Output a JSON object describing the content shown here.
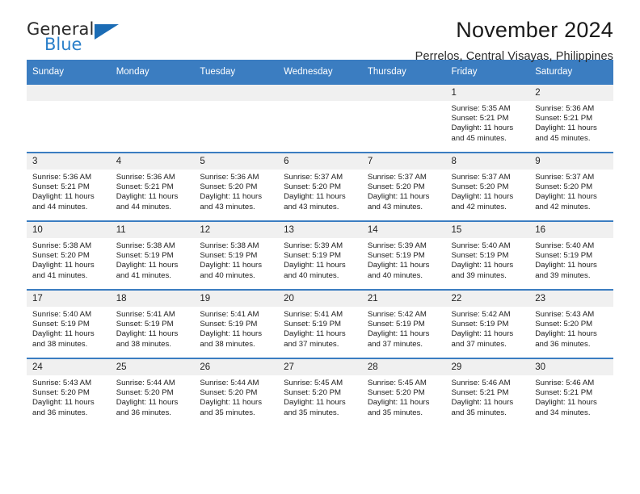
{
  "brand": {
    "name_top": "General",
    "name_bottom": "Blue",
    "accent_color": "#2a7fc9",
    "triangle_color": "#1b6cb5"
  },
  "header": {
    "title": "November 2024",
    "subtitle": "Perrelos, Central Visayas, Philippines",
    "header_bg_color": "#3b7dc1",
    "daynum_bg_color": "#f0f0f0"
  },
  "weekdays": [
    "Sunday",
    "Monday",
    "Tuesday",
    "Wednesday",
    "Thursday",
    "Friday",
    "Saturday"
  ],
  "labels": {
    "sunrise": "Sunrise:",
    "sunset": "Sunset:",
    "daylight": "Daylight:"
  },
  "weeks": [
    [
      {
        "day": "",
        "blank": true
      },
      {
        "day": "",
        "blank": true
      },
      {
        "day": "",
        "blank": true
      },
      {
        "day": "",
        "blank": true
      },
      {
        "day": "",
        "blank": true
      },
      {
        "day": "1",
        "sunrise": "Sunrise: 5:35 AM",
        "sunset": "Sunset: 5:21 PM",
        "daylight": "Daylight: 11 hours and 45 minutes."
      },
      {
        "day": "2",
        "sunrise": "Sunrise: 5:36 AM",
        "sunset": "Sunset: 5:21 PM",
        "daylight": "Daylight: 11 hours and 45 minutes."
      }
    ],
    [
      {
        "day": "3",
        "sunrise": "Sunrise: 5:36 AM",
        "sunset": "Sunset: 5:21 PM",
        "daylight": "Daylight: 11 hours and 44 minutes."
      },
      {
        "day": "4",
        "sunrise": "Sunrise: 5:36 AM",
        "sunset": "Sunset: 5:21 PM",
        "daylight": "Daylight: 11 hours and 44 minutes."
      },
      {
        "day": "5",
        "sunrise": "Sunrise: 5:36 AM",
        "sunset": "Sunset: 5:20 PM",
        "daylight": "Daylight: 11 hours and 43 minutes."
      },
      {
        "day": "6",
        "sunrise": "Sunrise: 5:37 AM",
        "sunset": "Sunset: 5:20 PM",
        "daylight": "Daylight: 11 hours and 43 minutes."
      },
      {
        "day": "7",
        "sunrise": "Sunrise: 5:37 AM",
        "sunset": "Sunset: 5:20 PM",
        "daylight": "Daylight: 11 hours and 43 minutes."
      },
      {
        "day": "8",
        "sunrise": "Sunrise: 5:37 AM",
        "sunset": "Sunset: 5:20 PM",
        "daylight": "Daylight: 11 hours and 42 minutes."
      },
      {
        "day": "9",
        "sunrise": "Sunrise: 5:37 AM",
        "sunset": "Sunset: 5:20 PM",
        "daylight": "Daylight: 11 hours and 42 minutes."
      }
    ],
    [
      {
        "day": "10",
        "sunrise": "Sunrise: 5:38 AM",
        "sunset": "Sunset: 5:20 PM",
        "daylight": "Daylight: 11 hours and 41 minutes."
      },
      {
        "day": "11",
        "sunrise": "Sunrise: 5:38 AM",
        "sunset": "Sunset: 5:19 PM",
        "daylight": "Daylight: 11 hours and 41 minutes."
      },
      {
        "day": "12",
        "sunrise": "Sunrise: 5:38 AM",
        "sunset": "Sunset: 5:19 PM",
        "daylight": "Daylight: 11 hours and 40 minutes."
      },
      {
        "day": "13",
        "sunrise": "Sunrise: 5:39 AM",
        "sunset": "Sunset: 5:19 PM",
        "daylight": "Daylight: 11 hours and 40 minutes."
      },
      {
        "day": "14",
        "sunrise": "Sunrise: 5:39 AM",
        "sunset": "Sunset: 5:19 PM",
        "daylight": "Daylight: 11 hours and 40 minutes."
      },
      {
        "day": "15",
        "sunrise": "Sunrise: 5:40 AM",
        "sunset": "Sunset: 5:19 PM",
        "daylight": "Daylight: 11 hours and 39 minutes."
      },
      {
        "day": "16",
        "sunrise": "Sunrise: 5:40 AM",
        "sunset": "Sunset: 5:19 PM",
        "daylight": "Daylight: 11 hours and 39 minutes."
      }
    ],
    [
      {
        "day": "17",
        "sunrise": "Sunrise: 5:40 AM",
        "sunset": "Sunset: 5:19 PM",
        "daylight": "Daylight: 11 hours and 38 minutes."
      },
      {
        "day": "18",
        "sunrise": "Sunrise: 5:41 AM",
        "sunset": "Sunset: 5:19 PM",
        "daylight": "Daylight: 11 hours and 38 minutes."
      },
      {
        "day": "19",
        "sunrise": "Sunrise: 5:41 AM",
        "sunset": "Sunset: 5:19 PM",
        "daylight": "Daylight: 11 hours and 38 minutes."
      },
      {
        "day": "20",
        "sunrise": "Sunrise: 5:41 AM",
        "sunset": "Sunset: 5:19 PM",
        "daylight": "Daylight: 11 hours and 37 minutes."
      },
      {
        "day": "21",
        "sunrise": "Sunrise: 5:42 AM",
        "sunset": "Sunset: 5:19 PM",
        "daylight": "Daylight: 11 hours and 37 minutes."
      },
      {
        "day": "22",
        "sunrise": "Sunrise: 5:42 AM",
        "sunset": "Sunset: 5:19 PM",
        "daylight": "Daylight: 11 hours and 37 minutes."
      },
      {
        "day": "23",
        "sunrise": "Sunrise: 5:43 AM",
        "sunset": "Sunset: 5:20 PM",
        "daylight": "Daylight: 11 hours and 36 minutes."
      }
    ],
    [
      {
        "day": "24",
        "sunrise": "Sunrise: 5:43 AM",
        "sunset": "Sunset: 5:20 PM",
        "daylight": "Daylight: 11 hours and 36 minutes."
      },
      {
        "day": "25",
        "sunrise": "Sunrise: 5:44 AM",
        "sunset": "Sunset: 5:20 PM",
        "daylight": "Daylight: 11 hours and 36 minutes."
      },
      {
        "day": "26",
        "sunrise": "Sunrise: 5:44 AM",
        "sunset": "Sunset: 5:20 PM",
        "daylight": "Daylight: 11 hours and 35 minutes."
      },
      {
        "day": "27",
        "sunrise": "Sunrise: 5:45 AM",
        "sunset": "Sunset: 5:20 PM",
        "daylight": "Daylight: 11 hours and 35 minutes."
      },
      {
        "day": "28",
        "sunrise": "Sunrise: 5:45 AM",
        "sunset": "Sunset: 5:20 PM",
        "daylight": "Daylight: 11 hours and 35 minutes."
      },
      {
        "day": "29",
        "sunrise": "Sunrise: 5:46 AM",
        "sunset": "Sunset: 5:21 PM",
        "daylight": "Daylight: 11 hours and 35 minutes."
      },
      {
        "day": "30",
        "sunrise": "Sunrise: 5:46 AM",
        "sunset": "Sunset: 5:21 PM",
        "daylight": "Daylight: 11 hours and 34 minutes."
      }
    ]
  ]
}
